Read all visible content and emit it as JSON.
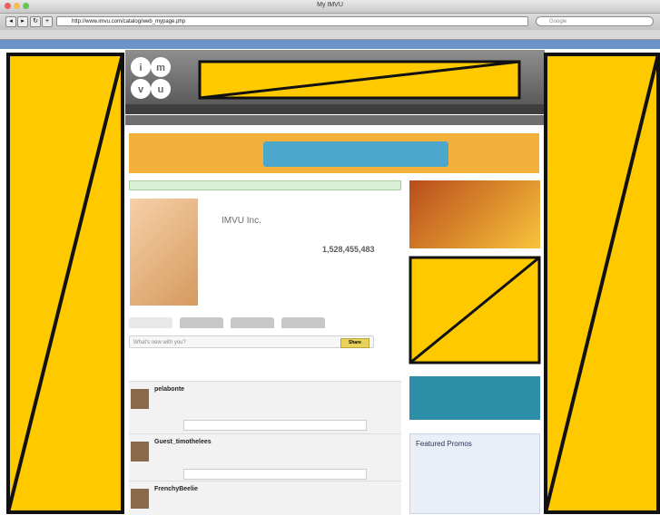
{
  "browser": {
    "title": "My IMVU",
    "url": "http://www.imvu.com/catalog/web_mypage.php",
    "search_placeholder": "Google"
  },
  "imvu": {
    "profile_name": "IMVU Inc.",
    "view_count": "1,528,455,483"
  },
  "status_box": {
    "placeholder": "What's new with you?",
    "button_label": "Share"
  },
  "feed": {
    "items": [
      {
        "name": "pelabonte"
      },
      {
        "name": "Guest_timothelees"
      },
      {
        "name": "FrenchyBeelie"
      }
    ]
  },
  "sidebar": {
    "promos_title": "Featured Promos"
  },
  "colors": {
    "overlay_yellow": "#FFC900",
    "overlay_border": "#111111",
    "header_gray": "#6f6f6f",
    "notice_blue": "#6b93c7"
  }
}
